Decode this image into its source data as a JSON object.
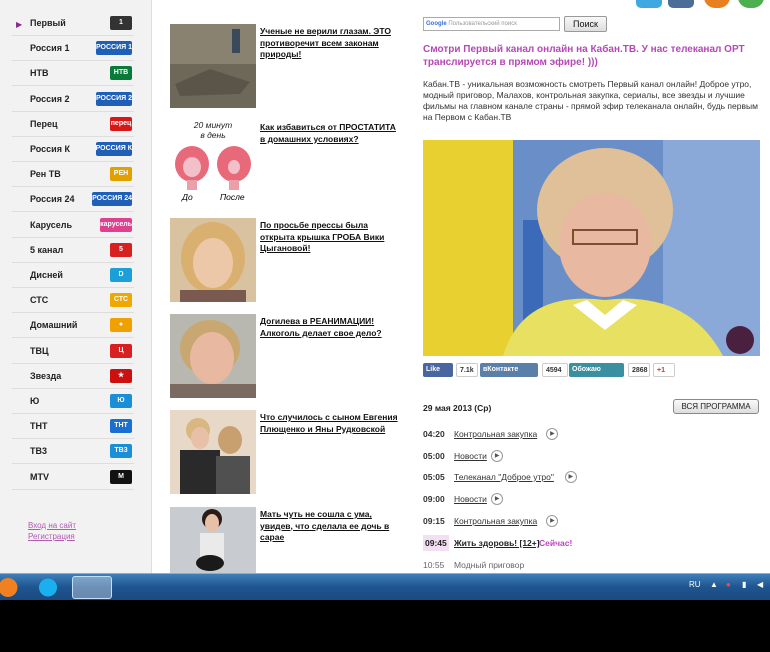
{
  "sidebar": {
    "channels": [
      {
        "name": "Первый",
        "logo": "1",
        "color": "#333"
      },
      {
        "name": "Россия 1",
        "logo": "РОССИЯ 1",
        "color": "#1f5fb8"
      },
      {
        "name": "НТВ",
        "logo": "НТВ",
        "color": "#0a7a3a"
      },
      {
        "name": "Россия 2",
        "logo": "РОССИЯ 2",
        "color": "#1f5fb8"
      },
      {
        "name": "Перец",
        "logo": "перец",
        "color": "#d81818"
      },
      {
        "name": "Россия К",
        "logo": "РОССИЯ К",
        "color": "#1f5fb8"
      },
      {
        "name": "Рен ТВ",
        "logo": "РЕН",
        "color": "#e0a000"
      },
      {
        "name": "Россия 24",
        "logo": "РОССИЯ 24",
        "color": "#1f5fb8"
      },
      {
        "name": "Карусель",
        "logo": "карусель",
        "color": "#e04090"
      },
      {
        "name": "5 канал",
        "logo": "5",
        "color": "#d82020"
      },
      {
        "name": "Дисней",
        "logo": "D",
        "color": "#1a9fd8"
      },
      {
        "name": "СТС",
        "logo": "СТС",
        "color": "#f0a800"
      },
      {
        "name": "Домашний",
        "logo": "●",
        "color": "#f0a000"
      },
      {
        "name": "ТВЦ",
        "logo": "Ц",
        "color": "#d82020"
      },
      {
        "name": "Звезда",
        "logo": "★",
        "color": "#cc1010"
      },
      {
        "name": "Ю",
        "logo": "Ю",
        "color": "#1a8fd8"
      },
      {
        "name": "ТНТ",
        "logo": "ТНТ",
        "color": "#1a6fd0"
      },
      {
        "name": "ТВ3",
        "logo": "ТВ3",
        "color": "#1a8fd8"
      },
      {
        "name": "MTV",
        "logo": "M",
        "color": "#111"
      }
    ],
    "links": [
      "Вход на сайт",
      "Регистрация"
    ]
  },
  "news": [
    "Ученые не верили глазам. ЭТО противоречит всем законам природы!",
    "Как избавиться от ПРОСТАТИТА в домашних условиях?",
    "По просьбе прессы была открыта крышка ГРОБА Вики Цыгановой!",
    "Догилева в РЕАНИМАЦИИ! Алкоголь делает свое дело?",
    "Что случилось с сыном Евгения Плющенко и Яны Рудковской",
    "Мать чуть не сошла с ума, увидев, что сделала ее дочь в сарае"
  ],
  "thumb2": {
    "top": "20 минут",
    "bottom": "в день",
    "before": "До",
    "after": "После"
  },
  "search": {
    "placeholder": "Пользовательский поиск",
    "google": "Google",
    "button": "Поиск"
  },
  "headline": "Смотри Первый канал онлайн на Кабан.ТВ. У нас телеканал ОРТ транслируется в прямом эфире! )))",
  "description": "Кабан.ТВ - уникальная возможность смотреть Первый канал онлайн! Доброе утро, модный приговор, Малахов, контрольная закупка, сериалы, все звезды и лучшие фильмы на главном канале страны - прямой эфир телеканала онлайн, будь первым на Первом с Кабан.ТВ",
  "share": {
    "like": "Like",
    "like_count": "7.1k",
    "vk": "вКонтакте",
    "vk_count": "4594",
    "obozhayu": "Обожаю",
    "ob_count": "2868",
    "plus": "+1"
  },
  "schedule": {
    "date": "29 мая 2013 (Ср)",
    "all_button": "ВСЯ ПРОГРАММА",
    "items": [
      {
        "time": "04:20",
        "name": "Контрольная закупка",
        "play": true
      },
      {
        "time": "05:00",
        "name": "Новости",
        "play": true
      },
      {
        "time": "05:05",
        "name": "Телеканал \"Доброе утро\"",
        "play": true
      },
      {
        "time": "09:00",
        "name": "Новости",
        "play": true
      },
      {
        "time": "09:15",
        "name": "Контрольная закупка",
        "play": true
      },
      {
        "time": "09:45",
        "name": "Жить здоровь! [12+]",
        "play": false,
        "now": "Сейчас!"
      },
      {
        "time": "10:55",
        "name": "Модный приговор",
        "play": false
      }
    ]
  },
  "taskbar": {
    "lang": "RU"
  }
}
